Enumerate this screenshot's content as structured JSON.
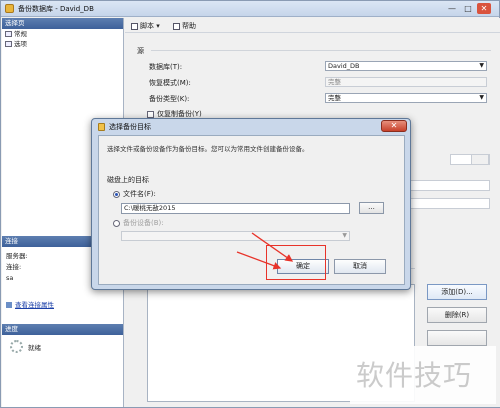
{
  "window": {
    "title": "备份数据库 - David_DB",
    "min": "—",
    "max": "□",
    "close": "✕"
  },
  "left_panel": {
    "pages_header": "选择页",
    "pages": [
      "常规",
      "选项"
    ],
    "connection_header": "连接",
    "connection": {
      "server_label": "服务器:",
      "server_value": "",
      "connection_label": "连接:",
      "connection_value": "sa"
    },
    "view_connection_link": "查看连接属性",
    "progress_header": "进度",
    "progress_status": "就绪"
  },
  "toolbar": {
    "script_label": "脚本",
    "help_label": "帮助"
  },
  "form": {
    "source_label": "源",
    "database_label": "数据库(T):",
    "database_value": "David_DB",
    "recovery_label": "恢复模式(M):",
    "recovery_value": "完整",
    "backup_type_label": "备份类型(K):",
    "backup_type_value": "完整",
    "copy_only_label": "仅复制备份(Y)"
  },
  "right_buttons": {
    "add_label": "添加(D)...",
    "remove_label": "删除(R)"
  },
  "dialog": {
    "title": "选择备份目标",
    "close": "✕",
    "description": "选择文件或备份设备作为备份目标。您可以为常用文件创建备份设备。",
    "group_label": "磁盘上的目标",
    "file_name_label": "文件名(F):",
    "file_path_value": "C:\\暖桃无敌2015",
    "browse_label": "...",
    "backup_device_label": "备份设备(B):",
    "ok_label": "确定",
    "cancel_label": "取消"
  },
  "watermark": {
    "text": "软件技巧"
  },
  "colors": {
    "highlight": "#e8332a",
    "arrow": "#e8332a"
  }
}
